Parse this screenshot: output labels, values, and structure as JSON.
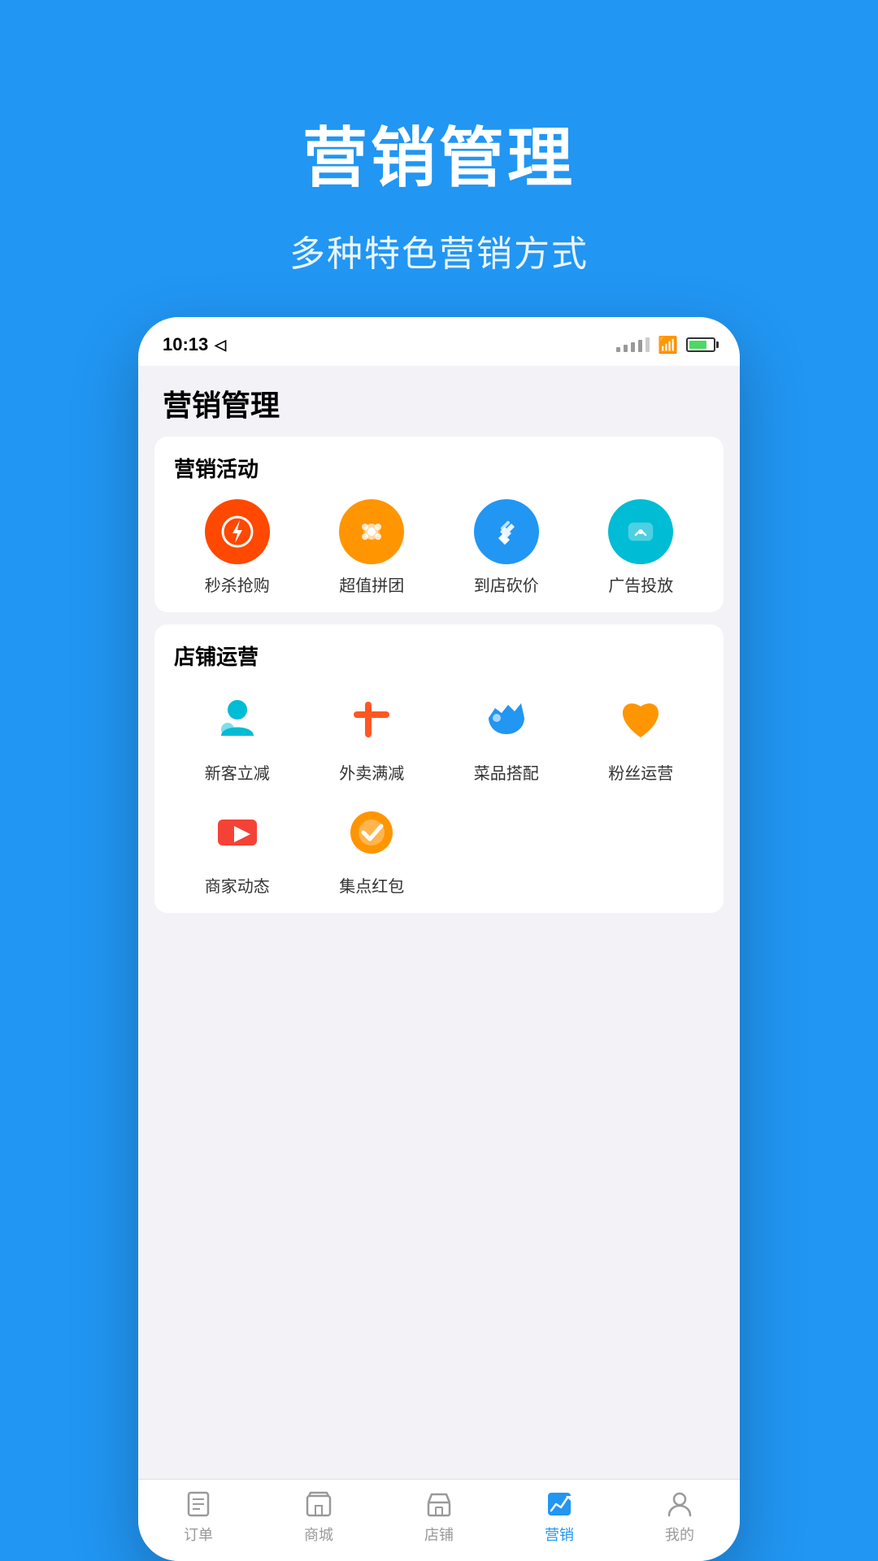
{
  "hero": {
    "title": "营销管理",
    "subtitle": "多种特色营销方式"
  },
  "status_bar": {
    "time": "10:13",
    "location_icon": "▶"
  },
  "page": {
    "title": "营销管理"
  },
  "marketing_section": {
    "title": "营销活动",
    "items": [
      {
        "id": "flash-sale",
        "label": "秒杀抢购",
        "color": "#FF4800",
        "icon": "flash"
      },
      {
        "id": "group-buy",
        "label": "超值拼团",
        "color": "#FF9500",
        "icon": "puzzle"
      },
      {
        "id": "in-store-discount",
        "label": "到店砍价",
        "color": "#2196F3",
        "icon": "tag"
      },
      {
        "id": "ads",
        "label": "广告投放",
        "color": "#00BCD4",
        "icon": "chat"
      }
    ]
  },
  "store_section": {
    "title": "店铺运营",
    "items": [
      {
        "id": "new-customer-discount",
        "label": "新客立减",
        "icon": "person-teal"
      },
      {
        "id": "delivery-discount",
        "label": "外卖满减",
        "icon": "fork-orange"
      },
      {
        "id": "dish-combo",
        "label": "菜品搭配",
        "icon": "thumbsup-blue"
      },
      {
        "id": "fan-ops",
        "label": "粉丝运营",
        "icon": "heart-yellow"
      },
      {
        "id": "merchant-updates",
        "label": "商家动态",
        "icon": "video-red"
      },
      {
        "id": "redpacket",
        "label": "集点红包",
        "icon": "check-orange"
      }
    ]
  },
  "bottom_nav": {
    "items": [
      {
        "id": "orders",
        "label": "订单",
        "active": false,
        "icon": "list"
      },
      {
        "id": "shop",
        "label": "商城",
        "active": false,
        "icon": "bag"
      },
      {
        "id": "store",
        "label": "店铺",
        "active": false,
        "icon": "store"
      },
      {
        "id": "marketing",
        "label": "营销",
        "active": true,
        "icon": "chart"
      },
      {
        "id": "mine",
        "label": "我的",
        "active": false,
        "icon": "person"
      }
    ]
  }
}
